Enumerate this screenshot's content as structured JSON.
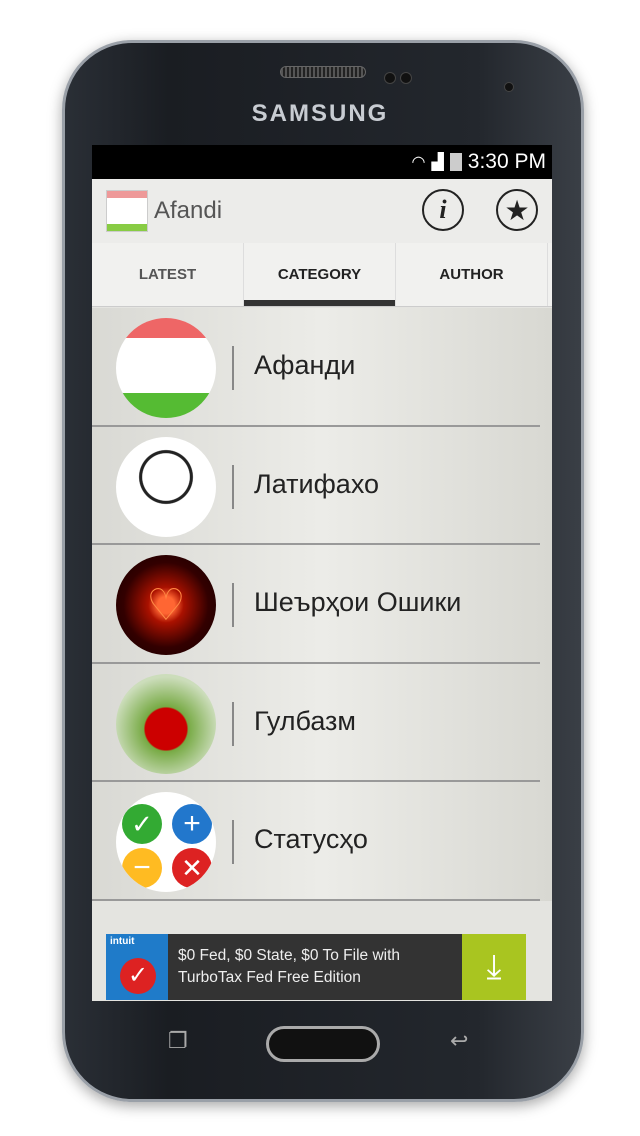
{
  "device": {
    "brand": "SAMSUNG"
  },
  "status_bar": {
    "time": "3:30 PM"
  },
  "app_bar": {
    "title": "Afandi",
    "info_icon": "info-icon",
    "favorites_icon": "star-icon"
  },
  "tabs": [
    {
      "label": "LATEST"
    },
    {
      "label": "CATEGORY",
      "selected": true
    },
    {
      "label": "AUTHOR"
    }
  ],
  "categories": [
    {
      "label": "Афанди"
    },
    {
      "label": "Латифахо"
    },
    {
      "label": "Шеърҳои Ошики"
    },
    {
      "label": "Гулбазм"
    },
    {
      "label": "Статусҳо"
    }
  ],
  "ad": {
    "brand": "intuit",
    "line1": "$0 Fed, $0 State, $0 To File with",
    "line2": "TurboTax Fed Free Edition",
    "accent": "#a9c520"
  }
}
